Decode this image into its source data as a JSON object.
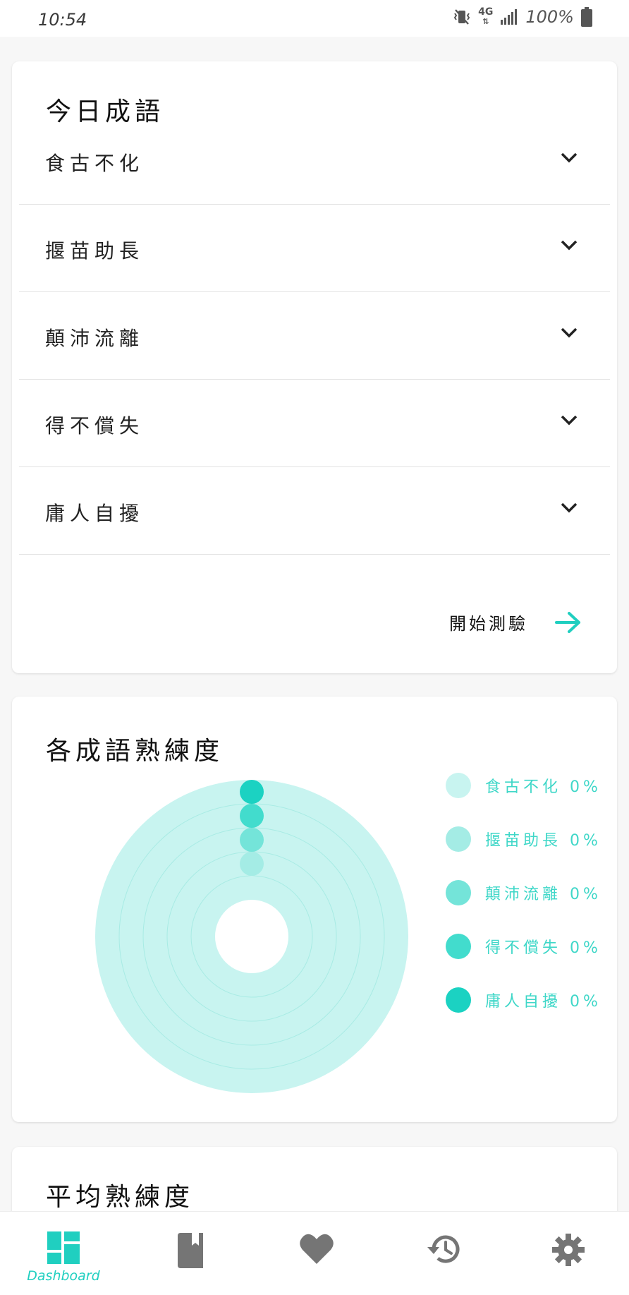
{
  "status_bar": {
    "time": "10:54",
    "network": "4G",
    "battery": "100%",
    "icons": [
      "vibrate-mute-icon",
      "network-4g-icon",
      "signal-bars-icon",
      "battery-icon"
    ]
  },
  "today_card": {
    "title": "今日成語",
    "idioms": [
      {
        "label": "食古不化"
      },
      {
        "label": "揠苗助長"
      },
      {
        "label": "顛沛流離"
      },
      {
        "label": "得不償失"
      },
      {
        "label": "庸人自擾"
      }
    ],
    "quiz_label": "開始測驗",
    "accent_color": "#20cfc0"
  },
  "proficiency_card": {
    "title": "各成語熟練度"
  },
  "chart_data": {
    "type": "radial-bar",
    "series": [
      {
        "name": "食古不化",
        "value": 0,
        "unit": "%",
        "color": "#c8f4f0"
      },
      {
        "name": "揠苗助長",
        "value": 0,
        "unit": "%",
        "color": "#a4ece5"
      },
      {
        "name": "顛沛流離",
        "value": 0,
        "unit": "%",
        "color": "#74e4d9"
      },
      {
        "name": "得不償失",
        "value": 0,
        "unit": "%",
        "color": "#42dccd"
      },
      {
        "name": "庸人自擾",
        "value": 0,
        "unit": "%",
        "color": "#1bd2c2"
      }
    ],
    "legend_labels": [
      "食古不化 0%",
      "揠苗助長 0%",
      "顛沛流離 0%",
      "得不償失 0%",
      "庸人自擾 0%"
    ],
    "legend_position": "right",
    "max": 100
  },
  "average_card": {
    "title": "平均熟練度"
  },
  "bottom_nav": {
    "items": [
      {
        "icon": "dashboard-icon",
        "label": "Dashboard",
        "active": true
      },
      {
        "icon": "book-icon",
        "label": "",
        "active": false
      },
      {
        "icon": "heart-icon",
        "label": "",
        "active": false
      },
      {
        "icon": "history-icon",
        "label": "",
        "active": false
      },
      {
        "icon": "settings-gear-icon",
        "label": "",
        "active": false
      }
    ]
  }
}
